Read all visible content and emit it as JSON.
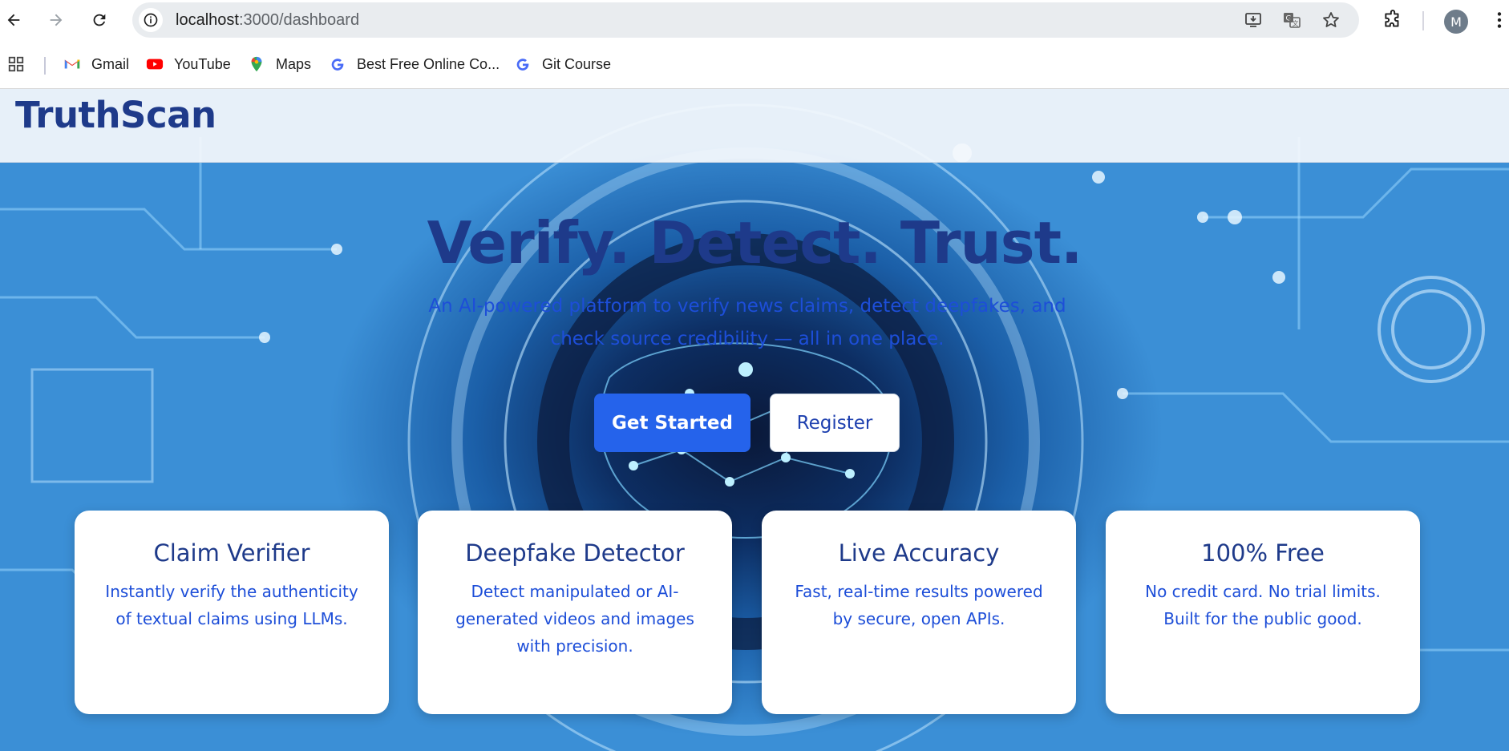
{
  "browser": {
    "url_host": "localhost",
    "url_rest": ":3000/dashboard",
    "avatar_letter": "M",
    "bookmarks": [
      {
        "label": "Gmail",
        "icon": "gmail-icon"
      },
      {
        "label": "YouTube",
        "icon": "youtube-icon"
      },
      {
        "label": "Maps",
        "icon": "maps-icon"
      },
      {
        "label": "Best Free Online Co...",
        "icon": "google-g-icon"
      },
      {
        "label": "Git Course",
        "icon": "google-g-icon"
      }
    ]
  },
  "app": {
    "logo": "TruthScan"
  },
  "hero": {
    "title": "Verify. Detect. Trust.",
    "subtitle": "An AI-powered platform to verify news claims, detect deepfakes, and check source credibility — all in one place.",
    "primary_button": "Get Started",
    "secondary_button": "Register"
  },
  "features": [
    {
      "title": "Claim Verifier",
      "description": "Instantly verify the authenticity of textual claims using LLMs."
    },
    {
      "title": "Deepfake Detector",
      "description": "Detect manipulated or AI-generated videos and images with precision."
    },
    {
      "title": "Live Accuracy",
      "description": "Fast, real-time results powered by secure, open APIs."
    },
    {
      "title": "100% Free",
      "description": "No credit card. No trial limits. Built for the public good."
    }
  ],
  "colors": {
    "brand": "#1e3a8a",
    "primary": "#2563eb",
    "accent_text": "#1d4ed8"
  }
}
